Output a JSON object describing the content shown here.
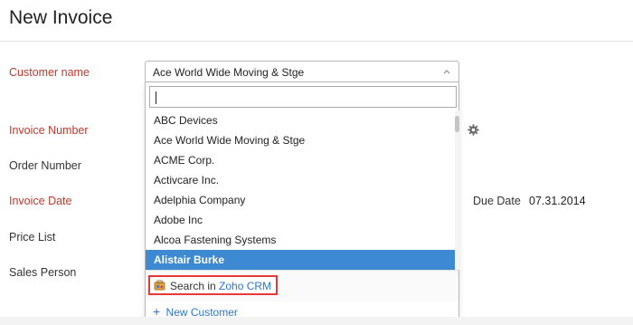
{
  "page": {
    "title": "New Invoice"
  },
  "form": {
    "customer_name_label": "Customer name",
    "invoice_number_label": "Invoice Number",
    "order_number_label": "Order Number",
    "invoice_date_label": "Invoice Date",
    "price_list_label": "Price List",
    "sales_person_label": "Sales Person",
    "due_date_label": "Due Date",
    "due_date_value": "07.31.2014"
  },
  "customer_select": {
    "selected_value": "Ace World Wide Moving & Stge",
    "search_value": "",
    "options": [
      "ABC Devices",
      "Ace World Wide Moving & Stge",
      "ACME Corp.",
      "Activcare Inc.",
      "Adelphia Company",
      "Adobe Inc",
      "Alcoa Fastening Systems",
      "Alistair Burke"
    ],
    "highlighted_option": "Alistair Burke",
    "crm_search_prefix": "Search in",
    "crm_search_link": "Zoho CRM",
    "new_customer_plus": "+",
    "new_customer_label": "New Customer"
  },
  "colors": {
    "required_label": "#c0392b",
    "highlight": "#3d89d2",
    "link": "#2a76c8",
    "crm_outline": "#e53935"
  }
}
